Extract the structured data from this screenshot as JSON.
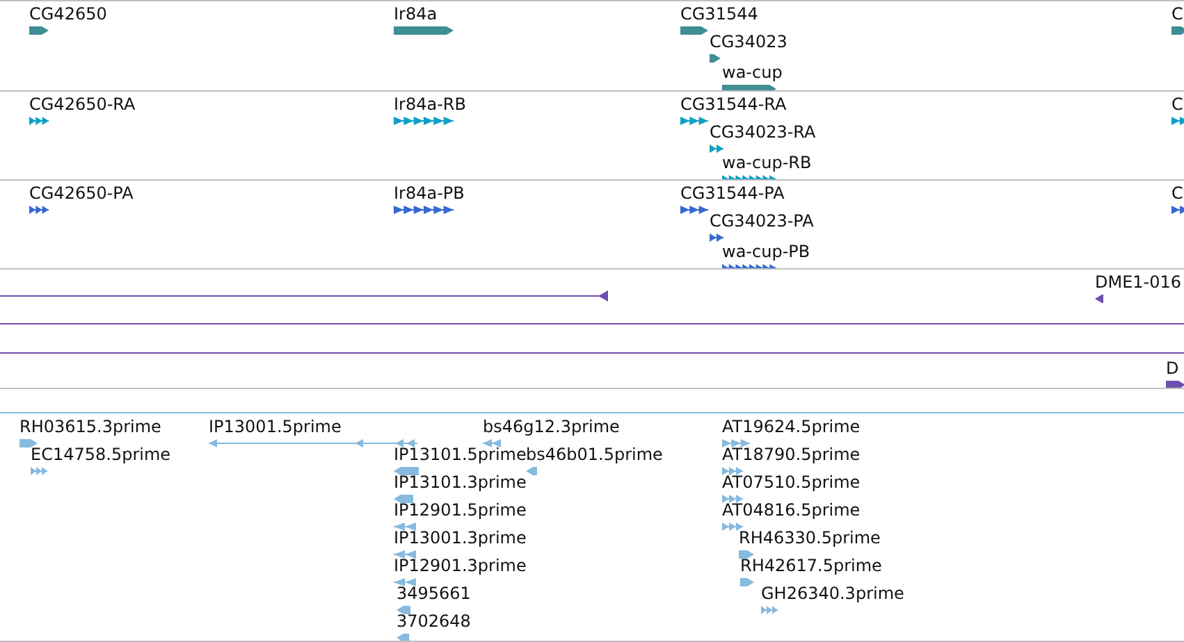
{
  "tracks": [
    {
      "kind": "gene",
      "color": "#3f8e93",
      "features": [
        {
          "label": "CG42650"
        },
        {
          "label": "Ir84a"
        },
        {
          "label": "CG31544"
        },
        {
          "label": "CG34023"
        },
        {
          "label": "wa-cup"
        },
        {
          "label": "C"
        }
      ]
    },
    {
      "kind": "transcript",
      "color": "#0ea0c6",
      "features": [
        {
          "label": "CG42650-RA"
        },
        {
          "label": "Ir84a-RB"
        },
        {
          "label": "CG31544-RA"
        },
        {
          "label": "CG34023-RA"
        },
        {
          "label": "wa-cup-RB"
        },
        {
          "label": "C"
        }
      ]
    },
    {
      "kind": "protein",
      "color": "#3568d4",
      "features": [
        {
          "label": "CG42650-PA"
        },
        {
          "label": "Ir84a-PB"
        },
        {
          "label": "CG31544-PA"
        },
        {
          "label": "CG34023-PA"
        },
        {
          "label": "wa-cup-PB"
        },
        {
          "label": "C"
        }
      ]
    },
    {
      "kind": "alignment",
      "color": "#6f4fae",
      "features": [
        {
          "label": "DME1-016"
        },
        {
          "label": "D"
        }
      ]
    },
    {
      "kind": "est",
      "color": "#86badf",
      "features": [
        {
          "label": "RH03615.3prime"
        },
        {
          "label": "IP13001.5prime"
        },
        {
          "label": "bs46g12.3prime"
        },
        {
          "label": "AT19624.5prime"
        },
        {
          "label": "EC14758.5prime"
        },
        {
          "label": "IP13101.5prime"
        },
        {
          "label": "bs46b01.5prime"
        },
        {
          "label": "AT18790.5prime"
        },
        {
          "label": "IP13101.3prime"
        },
        {
          "label": "AT07510.5prime"
        },
        {
          "label": "IP12901.5prime"
        },
        {
          "label": "AT04816.5prime"
        },
        {
          "label": "IP13001.3prime"
        },
        {
          "label": "RH46330.5prime"
        },
        {
          "label": "IP12901.3prime"
        },
        {
          "label": "RH42617.5prime"
        },
        {
          "label": "3495661"
        },
        {
          "label": "GH26340.3prime"
        },
        {
          "label": "3702648"
        }
      ]
    }
  ]
}
